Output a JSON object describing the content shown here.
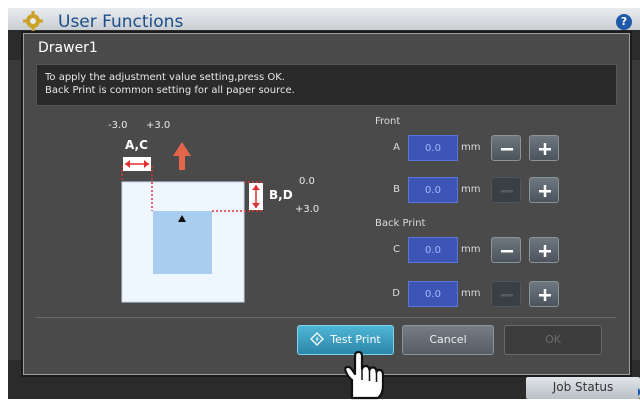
{
  "app": {
    "title": "User Functions",
    "help_label": "?",
    "job_status_label": "Job Status"
  },
  "dialog": {
    "title": "Drawer1",
    "message_lines": [
      "To apply the adjustment value setting,press OK.",
      "Back Print is common setting for all paper source."
    ]
  },
  "diagram": {
    "ac_range_left": "-3.0",
    "ac_range_right": "+3.0",
    "ac_label": "A,C",
    "bd_label": "B,D",
    "bd_range_top": "0.0",
    "bd_range_bottom": "+3.0"
  },
  "front": {
    "section_label": "Front",
    "fields": [
      {
        "letter": "A",
        "value": "0.0",
        "unit": "mm",
        "minus_enabled": true
      },
      {
        "letter": "B",
        "value": "0.0",
        "unit": "mm",
        "minus_enabled": false
      }
    ]
  },
  "back_print": {
    "section_label": "Back Print",
    "fields": [
      {
        "letter": "C",
        "value": "0.0",
        "unit": "mm",
        "minus_enabled": true
      },
      {
        "letter": "D",
        "value": "0.0",
        "unit": "mm",
        "minus_enabled": false
      }
    ]
  },
  "buttons": {
    "test_print": "Test Print",
    "cancel": "Cancel",
    "ok": "OK"
  },
  "icons": {
    "settings": "gear-icon",
    "test_print": "test-print-icon",
    "pointer": "hand-pointer-icon",
    "up_arrow": "up-arrow-icon"
  },
  "colors": {
    "accent_blue": "#3d56b6",
    "test_print_button": "#3a9ec2",
    "arrow_orange": "#e2674a"
  }
}
